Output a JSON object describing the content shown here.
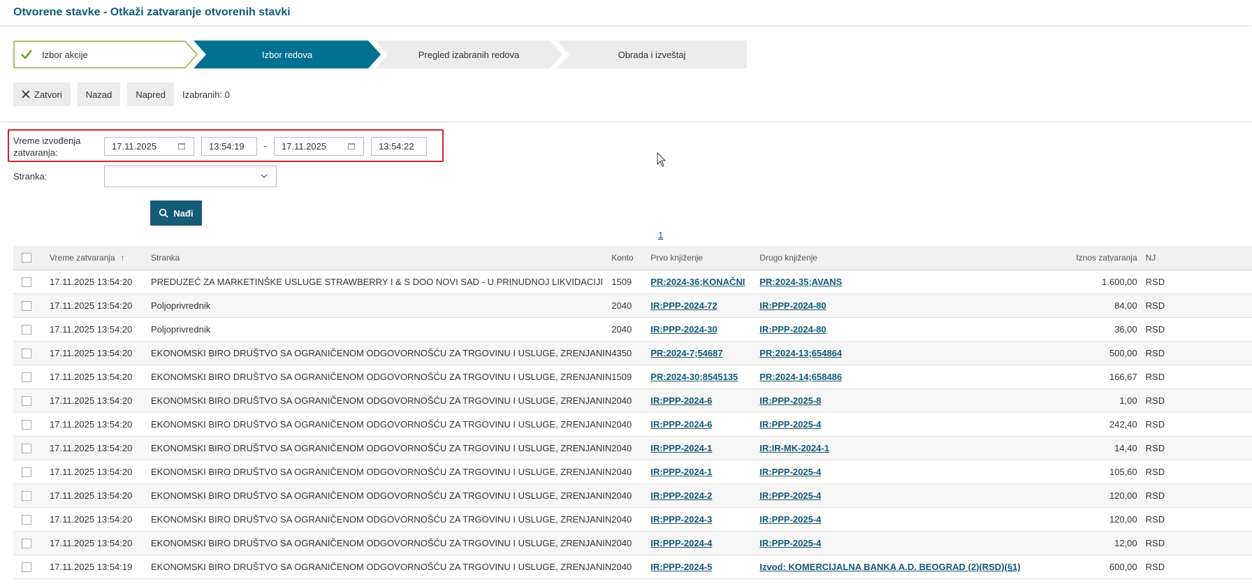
{
  "page": {
    "title": "Otvorene stavke - Otkaži zatvaranje otvorenih stavki"
  },
  "wizard": {
    "steps": [
      {
        "label": "Izbor akcije",
        "state": "done"
      },
      {
        "label": "Izbor redova",
        "state": "active"
      },
      {
        "label": "Pregled izabranih redova",
        "state": "pending"
      },
      {
        "label": "Obrada i izveštaj",
        "state": "pending"
      }
    ]
  },
  "toolbar": {
    "close_label": "Zatvori",
    "back_label": "Nazad",
    "next_label": "Napred",
    "selected_text": "Izabranih: 0"
  },
  "filters": {
    "time_label_line1": "Vreme izvođenja",
    "time_label_line2": "zatvaranja:",
    "date_from": "17.11.2025",
    "time_from": "13:54:19",
    "separator": "-",
    "date_to": "17.11.2025",
    "time_to": "13:54:22",
    "party_label": "Stranka:",
    "party_value": ""
  },
  "search": {
    "label": "Nađi"
  },
  "pager": {
    "page": "1"
  },
  "table": {
    "columns": [
      "Vreme zatvaranja",
      "Stranka",
      "Konto",
      "Prvo knjiženje",
      "Drugo knjiženje",
      "Iznos zatvaranja",
      "NJ"
    ],
    "rows": [
      {
        "time": "17.11.2025 13:54:20",
        "party": "PREDUZEĆ ZA MARKETINŠKE USLUGE STRAWBERRY I & S DOO NOVI SAD - U PRINUDNOJ LIKVIDACIJI",
        "konto": "1509",
        "first": "PR:2024-36;KONAČNI",
        "second": "PR:2024-35;AVANS",
        "amount": "1.600,00",
        "cur": "RSD"
      },
      {
        "time": "17.11.2025 13:54:20",
        "party": "Poljoprivrednik",
        "konto": "2040",
        "first": "IR:PPP-2024-72",
        "second": "IR:PPP-2024-80",
        "amount": "84,00",
        "cur": "RSD"
      },
      {
        "time": "17.11.2025 13:54:20",
        "party": "Poljoprivrednik",
        "konto": "2040",
        "first": "IR:PPP-2024-30",
        "second": "IR:PPP-2024-80",
        "amount": "36,00",
        "cur": "RSD"
      },
      {
        "time": "17.11.2025 13:54:20",
        "party": "EKONOMSKI BIRO DRUŠTVO SA OGRANIČENOM ODGOVORNOŠĆU ZA TRGOVINU I USLUGE, ZRENJANIN",
        "konto": "4350",
        "first": "PR:2024-7;54687",
        "second": "PR:2024-13;654864",
        "amount": "500,00",
        "cur": "RSD"
      },
      {
        "time": "17.11.2025 13:54:20",
        "party": "EKONOMSKI BIRO DRUŠTVO SA OGRANIČENOM ODGOVORNOŠĆU ZA TRGOVINU I USLUGE, ZRENJANIN",
        "konto": "1509",
        "first": "PR:2024-30;8545135",
        "second": "PR:2024-14;658486",
        "amount": "166,67",
        "cur": "RSD"
      },
      {
        "time": "17.11.2025 13:54:20",
        "party": "EKONOMSKI BIRO DRUŠTVO SA OGRANIČENOM ODGOVORNOŠĆU ZA TRGOVINU I USLUGE, ZRENJANIN",
        "konto": "2040",
        "first": "IR:PPP-2024-6",
        "second": "IR:PPP-2025-8",
        "amount": "1,00",
        "cur": "RSD"
      },
      {
        "time": "17.11.2025 13:54:20",
        "party": "EKONOMSKI BIRO DRUŠTVO SA OGRANIČENOM ODGOVORNOŠĆU ZA TRGOVINU I USLUGE, ZRENJANIN",
        "konto": "2040",
        "first": "IR:PPP-2024-6",
        "second": "IR:PPP-2025-4",
        "amount": "242,40",
        "cur": "RSD"
      },
      {
        "time": "17.11.2025 13:54:20",
        "party": "EKONOMSKI BIRO DRUŠTVO SA OGRANIČENOM ODGOVORNOŠĆU ZA TRGOVINU I USLUGE, ZRENJANIN",
        "konto": "2040",
        "first": "IR:PPP-2024-1",
        "second": "IR:IR-MK-2024-1",
        "amount": "14,40",
        "cur": "RSD"
      },
      {
        "time": "17.11.2025 13:54:20",
        "party": "EKONOMSKI BIRO DRUŠTVO SA OGRANIČENOM ODGOVORNOŠĆU ZA TRGOVINU I USLUGE, ZRENJANIN",
        "konto": "2040",
        "first": "IR:PPP-2024-1",
        "second": "IR:PPP-2025-4",
        "amount": "105,60",
        "cur": "RSD"
      },
      {
        "time": "17.11.2025 13:54:20",
        "party": "EKONOMSKI BIRO DRUŠTVO SA OGRANIČENOM ODGOVORNOŠĆU ZA TRGOVINU I USLUGE, ZRENJANIN",
        "konto": "2040",
        "first": "IR:PPP-2024-2",
        "second": "IR:PPP-2025-4",
        "amount": "120,00",
        "cur": "RSD"
      },
      {
        "time": "17.11.2025 13:54:20",
        "party": "EKONOMSKI BIRO DRUŠTVO SA OGRANIČENOM ODGOVORNOŠĆU ZA TRGOVINU I USLUGE, ZRENJANIN",
        "konto": "2040",
        "first": "IR:PPP-2024-3",
        "second": "IR:PPP-2025-4",
        "amount": "120,00",
        "cur": "RSD"
      },
      {
        "time": "17.11.2025 13:54:20",
        "party": "EKONOMSKI BIRO DRUŠTVO SA OGRANIČENOM ODGOVORNOŠĆU ZA TRGOVINU I USLUGE, ZRENJANIN",
        "konto": "2040",
        "first": "IR:PPP-2024-4",
        "second": "IR:PPP-2025-4",
        "amount": "12,00",
        "cur": "RSD"
      },
      {
        "time": "17.11.2025 13:54:19",
        "party": "EKONOMSKI BIRO DRUŠTVO SA OGRANIČENOM ODGOVORNOŠĆU ZA TRGOVINU I USLUGE, ZRENJANIN",
        "konto": "2040",
        "first": "IR:PPP-2024-5",
        "second": "Izvod: KOMERCIJALNA BANKA A.D. BEOGRAD (2)(RSD)(§1)",
        "amount": "600,00",
        "cur": "RSD"
      }
    ]
  },
  "colors": {
    "accent": "#00718f",
    "title": "#135a7a",
    "done_border": "#8bb53d",
    "highlight": "#d9232d"
  }
}
